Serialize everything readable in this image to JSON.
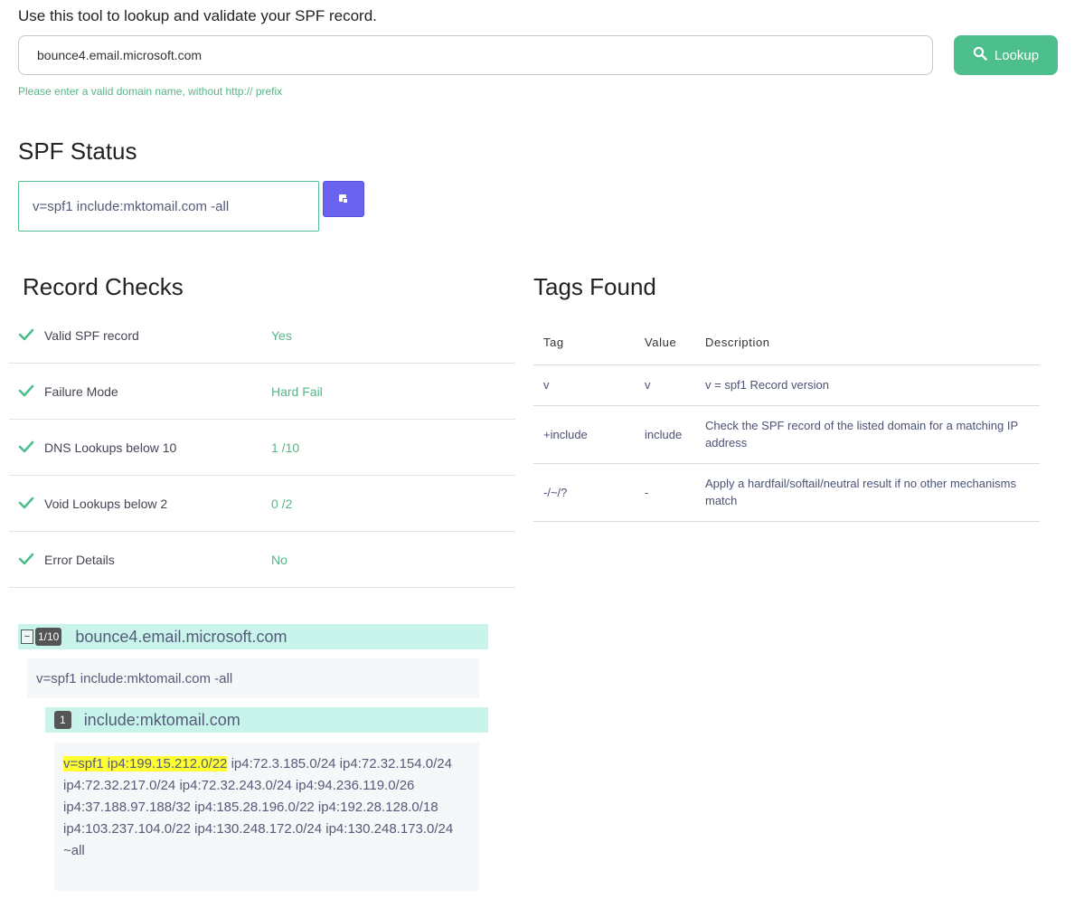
{
  "header": {
    "intro": "Use this tool to lookup and validate your SPF record.",
    "domain_value": "bounce4.email.microsoft.com",
    "lookup_label": "Lookup",
    "helper": "Please enter a valid domain name, without http:// prefix"
  },
  "spf_status": {
    "title": "SPF Status",
    "record": "v=spf1 include:mktomail.com -all"
  },
  "record_checks": {
    "title": "Record Checks",
    "rows": [
      {
        "label": "Valid SPF record",
        "value": "Yes"
      },
      {
        "label": "Failure Mode",
        "value": "Hard Fail"
      },
      {
        "label": "DNS Lookups below 10",
        "value": "1 /10"
      },
      {
        "label": "Void Lookups below 2",
        "value": "0 /2"
      },
      {
        "label": "Error Details",
        "value": "No"
      }
    ]
  },
  "tags_found": {
    "title": "Tags Found",
    "columns": [
      "Tag",
      "Value",
      "Description"
    ],
    "rows": [
      {
        "tag": "v",
        "value": "v",
        "description": "v = spf1 Record version"
      },
      {
        "tag": "+include",
        "value": "include",
        "description": "Check the SPF record of the listed domain for a matching IP address"
      },
      {
        "tag": "-/~/?",
        "value": "-",
        "description": "Apply a hardfail/softail/neutral result if no other mechanisms match"
      }
    ]
  },
  "tree": {
    "toggle": "−",
    "count_badge": "1/10",
    "domain": "bounce4.email.microsoft.com",
    "record": "v=spf1 include:mktomail.com -all",
    "child": {
      "index_badge": "1",
      "domain": "include:mktomail.com",
      "record_highlight": "v=spf1 ip4:199.15.212.0/22",
      "record_rest": " ip4:72.3.185.0/24 ip4:72.32.154.0/24 ip4:72.32.217.0/24 ip4:72.32.243.0/24 ip4:94.236.119.0/26 ip4:37.188.97.188/32 ip4:185.28.196.0/22 ip4:192.28.128.0/18 ip4:103.237.104.0/22 ip4:130.248.172.0/24 ip4:130.248.173.0/24 ~all"
    }
  },
  "colors": {
    "accent_green": "#4cbf8c",
    "copy_purple": "#6a63f0",
    "tree_header": "#c8f4ec",
    "highlight": "#ffff33"
  }
}
